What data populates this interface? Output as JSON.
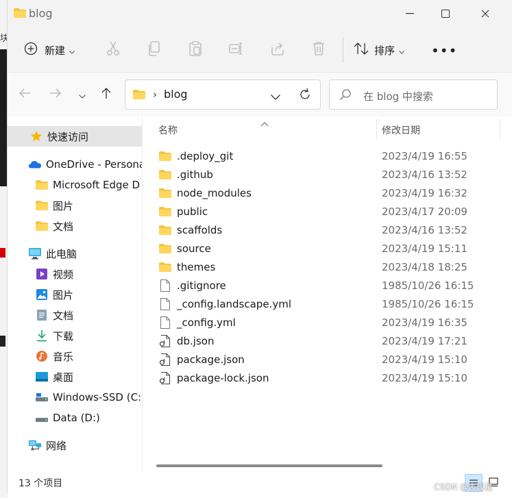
{
  "window": {
    "title": "blog"
  },
  "command_bar": {
    "new_label": "新建",
    "sort_label": "排序",
    "more_label": "•••"
  },
  "nav": {
    "path": "blog",
    "search_placeholder": "在 blog 中搜索"
  },
  "sidebar": {
    "items": [
      {
        "label": "快速访问",
        "icon": "star-icon"
      },
      {
        "label": "OneDrive - Persona",
        "icon": "cloud-icon"
      },
      {
        "label": "Microsoft Edge D",
        "icon": "folder-icon"
      },
      {
        "label": "图片",
        "icon": "folder-icon"
      },
      {
        "label": "文档",
        "icon": "folder-icon"
      },
      {
        "label": "此电脑",
        "icon": "computer-icon"
      },
      {
        "label": "视频",
        "icon": "video-icon"
      },
      {
        "label": "图片",
        "icon": "pictures-icon"
      },
      {
        "label": "文档",
        "icon": "documents-icon"
      },
      {
        "label": "下载",
        "icon": "download-icon"
      },
      {
        "label": "音乐",
        "icon": "music-icon"
      },
      {
        "label": "桌面",
        "icon": "desktop-icon"
      },
      {
        "label": "Windows-SSD (C:)",
        "icon": "drive-icon"
      },
      {
        "label": "Data (D:)",
        "icon": "drive-icon"
      },
      {
        "label": "网络",
        "icon": "network-icon"
      }
    ]
  },
  "table": {
    "headers": {
      "name": "名称",
      "date": "修改日期"
    },
    "rows": [
      {
        "name": ".deploy_git",
        "date": "2023/4/19 16:55",
        "type": "folder"
      },
      {
        "name": ".github",
        "date": "2023/4/16 13:52",
        "type": "folder"
      },
      {
        "name": "node_modules",
        "date": "2023/4/19 16:32",
        "type": "folder"
      },
      {
        "name": "public",
        "date": "2023/4/17 20:09",
        "type": "folder"
      },
      {
        "name": "scaffolds",
        "date": "2023/4/16 13:52",
        "type": "folder"
      },
      {
        "name": "source",
        "date": "2023/4/19 15:11",
        "type": "folder"
      },
      {
        "name": "themes",
        "date": "2023/4/18 18:25",
        "type": "folder"
      },
      {
        "name": ".gitignore",
        "date": "1985/10/26 16:15",
        "type": "file"
      },
      {
        "name": "_config.landscape.yml",
        "date": "1985/10/26 16:15",
        "type": "file"
      },
      {
        "name": "_config.yml",
        "date": "2023/4/19 16:35",
        "type": "file"
      },
      {
        "name": "db.json",
        "date": "2023/4/19 17:21",
        "type": "json"
      },
      {
        "name": "package.json",
        "date": "2023/4/19 15:10",
        "type": "json"
      },
      {
        "name": "package-lock.json",
        "date": "2023/4/19 15:10",
        "type": "json"
      }
    ]
  },
  "status": {
    "count_text": "13 个项目"
  },
  "watermark": "CSDN @表现星",
  "colors": {
    "folder": "#f4c542",
    "accent": "#0067c0",
    "selected_bg": "#e5e5e5"
  }
}
